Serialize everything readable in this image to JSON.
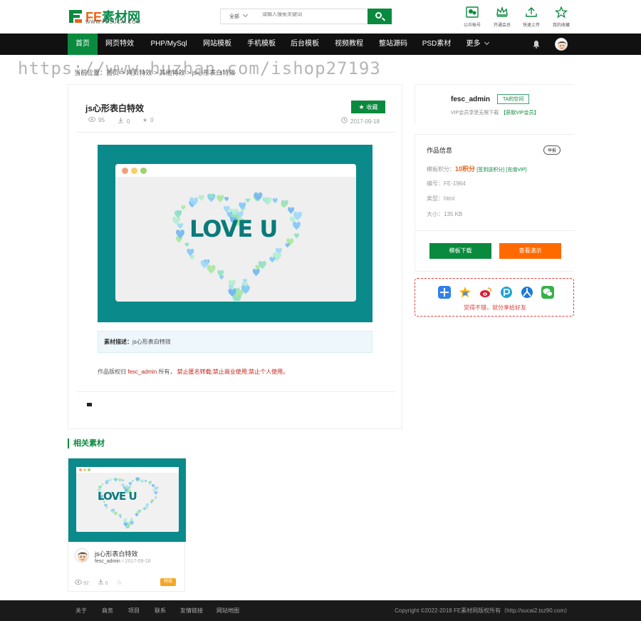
{
  "header": {
    "logo_fe": "FE",
    "logo_name": "素材网",
    "logo_sub": "WWW.FESUCAI.COM",
    "search": {
      "scope": "全部",
      "placeholder": "请输入搜索关键词"
    },
    "quick_links": [
      {
        "label": "公众帐号",
        "icon": "qrcode-icon"
      },
      {
        "label": "开通会员",
        "icon": "crown-icon"
      },
      {
        "label": "快速上传",
        "icon": "upload-icon"
      },
      {
        "label": "我的收藏",
        "icon": "star-icon"
      }
    ]
  },
  "nav": {
    "items": [
      "首页",
      "网页特效",
      "PHP/MySql",
      "网站模板",
      "手机模板",
      "后台模板",
      "视频教程",
      "整站源码",
      "PSD素材",
      "更多"
    ],
    "active": "首页"
  },
  "breadcrumb": "当前位置：首页 > 网页特效 > 其他特效 > js心形表白特效",
  "watermark": "https://www.huzhan.com/ishop27193",
  "main": {
    "title": "js心形表白特效",
    "collect_label": "收藏",
    "views": "95",
    "downloads": "0",
    "likes": "0",
    "date": "2017-09-18",
    "preview_text": "LOVE U",
    "desc_label": "素材描述：",
    "desc_value": "js心形表白特效",
    "copyright_prefix": "作品版权归",
    "copyright_author": "fesc_admin",
    "copyright_mid": "所有，",
    "copyright_warning": "禁止匿名转载;禁止商业使用;禁止个人使用。"
  },
  "related": {
    "title": "相关素材",
    "items": [
      {
        "name": "js心形表白特效",
        "author": "fesc_admin",
        "date": "/ 2017-09-18",
        "views": "92",
        "downloads": "0",
        "tag": "特效",
        "preview_text": "LOVE U"
      }
    ]
  },
  "sidebar": {
    "author": {
      "name": "fesc_admin",
      "space_label": "TA的空间",
      "vip_text": "VIP会员享受无限下载",
      "vip_link": "【获取VIP会员】"
    },
    "info": {
      "title": "作品信息",
      "report": "举报",
      "price_label": "模板积分：",
      "price_value": "10积分",
      "price_link1": "[签到送积分]",
      "price_link2": "[充值VIP]",
      "id_label": "编号：",
      "id_value": "FE-1964",
      "type_label": "类型：",
      "type_value": "html",
      "size_label": "大小：",
      "size_value": "135 KB",
      "download_label": "模板下载",
      "demo_label": "查看演示"
    },
    "share": {
      "text": "觉得不错，就分享给好友",
      "icons": [
        "plus-share-icon",
        "qzone-icon",
        "weibo-icon",
        "pocket-icon",
        "renren-icon",
        "wechat-icon"
      ]
    }
  },
  "footer": {
    "links": [
      "关于",
      "商务",
      "项目",
      "联系",
      "友情链接",
      "网站地图"
    ],
    "copyright": "Copyright ©2022-2018 FE素材网版权所有（http://sucai2.tsz90.com）"
  },
  "colors": {
    "brand_green": "#0a8a3e",
    "accent_orange": "#ff6a00",
    "teal_preview": "#0a8a8a",
    "share_red": "#e23b3b"
  }
}
